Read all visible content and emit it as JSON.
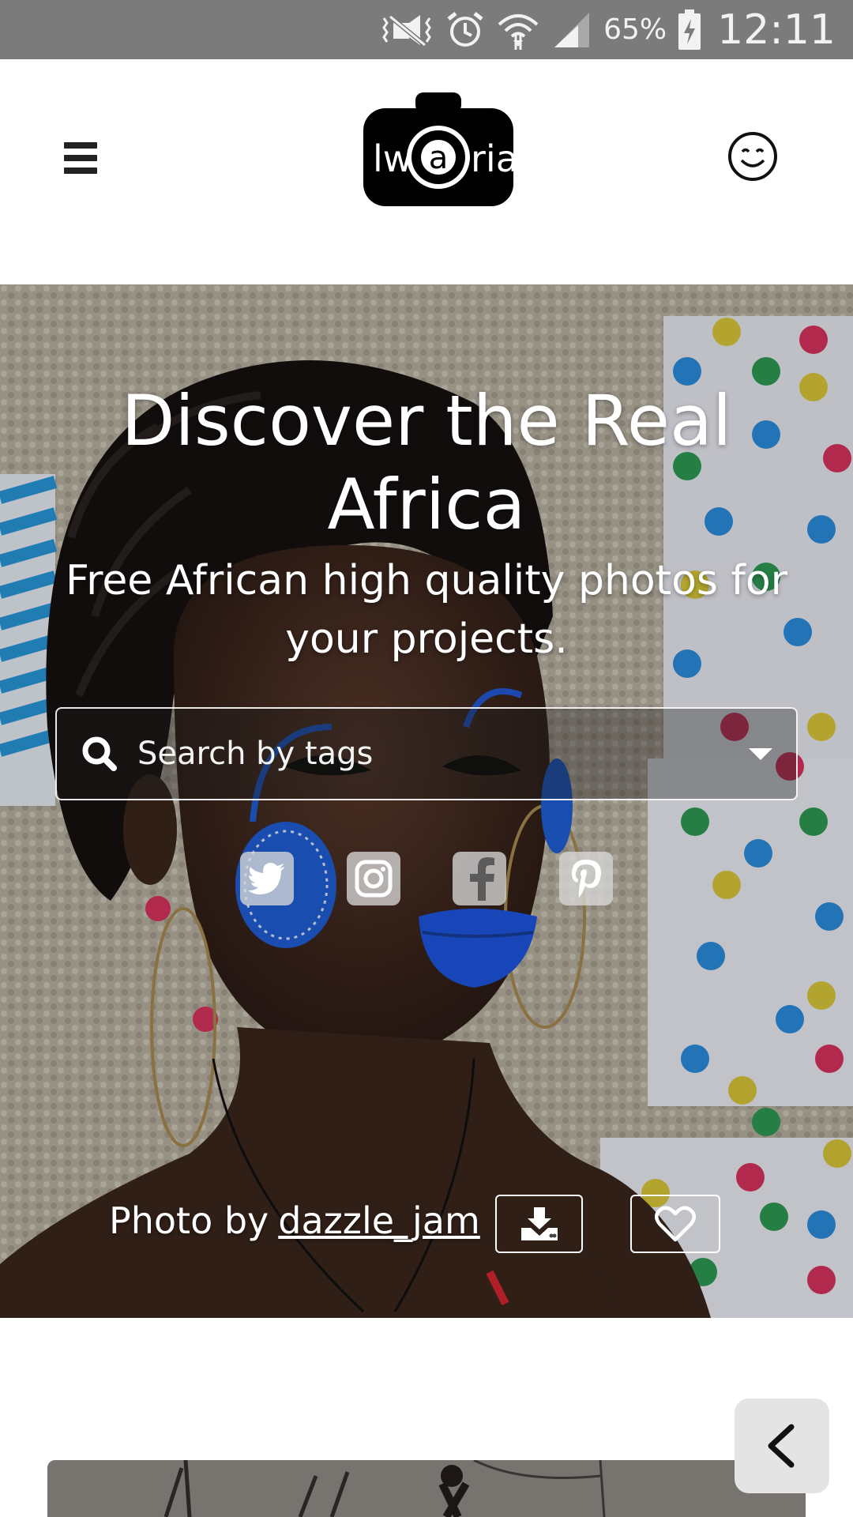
{
  "status_bar": {
    "battery_percent": "65%",
    "time": "12:11",
    "icons": [
      "vibrate-icon",
      "alarm-icon",
      "wifi-icon",
      "cellular-signal-icon",
      "battery-charging-icon"
    ]
  },
  "header": {
    "logo_text": "lwaria",
    "menu_icon": "hamburger-menu-icon",
    "account_icon": "smiley-account-icon"
  },
  "hero": {
    "title": "Discover the Real Africa",
    "subtitle": "Free African high quality photos for your projects.",
    "search": {
      "placeholder": "Search by tags",
      "value": ""
    },
    "social": [
      "twitter-icon",
      "instagram-icon",
      "facebook-icon",
      "pinterest-icon"
    ],
    "credit_prefix": "Photo by",
    "credit_author": "dazzle_jam",
    "download_icon": "download-icon",
    "favorite_icon": "heart-icon"
  },
  "colors": {
    "status_bar": "#7b7b7b",
    "page_bg": "#ffffff",
    "hero_text": "#ffffff",
    "fab_bg": "#e4e4e4",
    "accent_blue": "#1f5fd6"
  }
}
